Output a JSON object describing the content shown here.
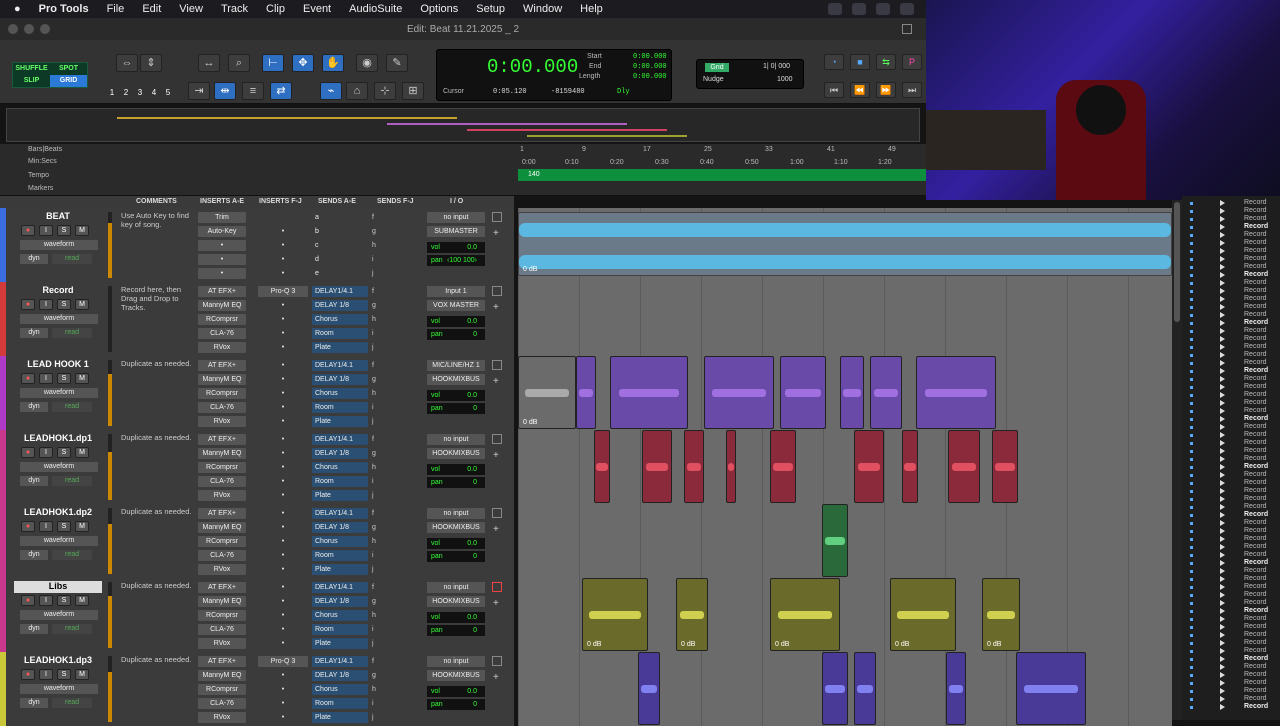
{
  "menubar": {
    "app": "Pro Tools",
    "items": [
      "File",
      "Edit",
      "View",
      "Track",
      "Clip",
      "Event",
      "AudioSuite",
      "Options",
      "Setup",
      "Window",
      "Help"
    ]
  },
  "window_title": "Edit: Beat 11.21.2025 _ 2",
  "modes": {
    "shuffle": "SHUFFLE",
    "spot": "SPOT",
    "slip": "SLIP",
    "grid": "GRID"
  },
  "toolbar": {
    "numbers": [
      "1",
      "2",
      "3",
      "4",
      "5"
    ]
  },
  "counter": {
    "main": "0:00.000",
    "start_lbl": "Start",
    "end_lbl": "End",
    "length_lbl": "Length",
    "start": "0:00.000",
    "end": "0:00.000",
    "length": "0:00.000",
    "cursor_lbl": "Cursor",
    "cursor": "0:05.120",
    "sample": "-8159480",
    "dly": "Dly"
  },
  "grid": {
    "grid_lbl": "Grid",
    "grid_val": "1| 0| 000",
    "nudge_lbl": "Nudge",
    "nudge_val": "1000"
  },
  "rulers": {
    "bars": "Bars|Beats",
    "min": "Min:Secs",
    "tempo": "Tempo",
    "markers": "Markers",
    "tempo_val": "140",
    "bar_ticks": [
      "1",
      "9",
      "17",
      "25",
      "33",
      "41",
      "49"
    ],
    "sec_ticks": [
      "0:00",
      "0:10",
      "0:20",
      "0:30",
      "0:40",
      "0:50",
      "1:00",
      "1:10",
      "1:20"
    ]
  },
  "columns": {
    "comments": "COMMENTS",
    "inserts_ae": "INSERTS A-E",
    "inserts_fj": "INSERTS F-J",
    "sends_ae": "SENDS A-E",
    "sends_fj": "SENDS F-J",
    "io": "I / O"
  },
  "tracks": [
    {
      "name": "BEAT",
      "color": "#3a6ee0",
      "comment": "Use Auto Key to find key of song.",
      "inserts": [
        "Trim",
        "Auto-Key",
        "•",
        "•",
        "•"
      ],
      "insfj": [
        "",
        "•",
        "•",
        "•",
        "•"
      ],
      "sends": [
        "a",
        "b",
        "c",
        "d",
        "e"
      ],
      "sendfj": [
        "f",
        "g",
        "h",
        "i",
        "j"
      ],
      "input": "no input",
      "output": "SUBMASTER",
      "vol": "0.0",
      "pan": "‹100   100›",
      "mode": "waveform",
      "dyn": "dyn",
      "read": "read",
      "clip_label": "0 dB"
    },
    {
      "name": "Record",
      "color": "#d33a3a",
      "comment": "Record here, then Drag and Drop to Tracks.",
      "inserts": [
        "AT EFX+",
        "MannyM EQ",
        "RComprsr",
        "CLA-76",
        "RVox"
      ],
      "insfj": [
        "Pro-Q 3",
        "•",
        "•",
        "•",
        "•"
      ],
      "sends": [
        "DELAY1/4.1",
        "DELAY 1/8",
        "Chorus",
        "Room",
        "Plate"
      ],
      "sendfj": [
        "f",
        "g",
        "h",
        "i",
        "j"
      ],
      "input": "Input 1",
      "output": "VOX MASTER",
      "vol": "0.0",
      "pan": "0",
      "mode": "waveform",
      "dyn": "dyn",
      "read": "read",
      "clip_label": ""
    },
    {
      "name": "LEAD HOOK 1",
      "color": "#b03ac8",
      "comment": "Duplicate as needed.",
      "inserts": [
        "AT EFX+",
        "MannyM EQ",
        "RComprsr",
        "CLA-76",
        "RVox"
      ],
      "insfj": [
        "•",
        "•",
        "•",
        "•",
        "•"
      ],
      "sends": [
        "DELAY1/4.1",
        "DELAY 1/8",
        "Chorus",
        "Room",
        "Plate"
      ],
      "sendfj": [
        "f",
        "g",
        "h",
        "i",
        "j"
      ],
      "input": "MIC/LINE/HZ 1",
      "output": "HOOKMIXBUS",
      "vol": "0.0",
      "pan": "0",
      "mode": "waveform",
      "dyn": "dyn",
      "read": "read",
      "clip_label": "0 dB"
    },
    {
      "name": "LEADHOK1.dp1",
      "color": "#c8388c",
      "comment": "Duplicate as needed.",
      "inserts": [
        "AT EFX+",
        "MannyM EQ",
        "RComprsr",
        "CLA-76",
        "RVox"
      ],
      "insfj": [
        "•",
        "•",
        "•",
        "•",
        "•"
      ],
      "sends": [
        "DELAY1/4.1",
        "DELAY 1/8",
        "Chorus",
        "Room",
        "Plate"
      ],
      "sendfj": [
        "f",
        "g",
        "h",
        "i",
        "j"
      ],
      "input": "no input",
      "output": "HOOKMIXBUS",
      "vol": "0.0",
      "pan": "0",
      "mode": "waveform",
      "dyn": "dyn",
      "read": "read",
      "clip_label": ""
    },
    {
      "name": "LEADHOK1.dp2",
      "color": "#c8388c",
      "comment": "Duplicate as needed.",
      "inserts": [
        "AT EFX+",
        "MannyM EQ",
        "RComprsr",
        "CLA-76",
        "RVox"
      ],
      "insfj": [
        "•",
        "•",
        "•",
        "•",
        "•"
      ],
      "sends": [
        "DELAY1/4.1",
        "DELAY 1/8",
        "Chorus",
        "Room",
        "Plate"
      ],
      "sendfj": [
        "f",
        "g",
        "h",
        "i",
        "j"
      ],
      "input": "no input",
      "output": "HOOKMIXBUS",
      "vol": "0.0",
      "pan": "0",
      "mode": "waveform",
      "dyn": "dyn",
      "read": "read",
      "clip_label": ""
    },
    {
      "name": "Libs",
      "color": "#c8388c",
      "comment": "Duplicate as needed.",
      "inserts": [
        "AT EFX+",
        "MannyM EQ",
        "RComprsr",
        "CLA-76",
        "RVox"
      ],
      "insfj": [
        "•",
        "•",
        "•",
        "•",
        "•"
      ],
      "sends": [
        "DELAY1/4.1",
        "DELAY 1/8",
        "Chorus",
        "Room",
        "Plate"
      ],
      "sendfj": [
        "f",
        "g",
        "h",
        "i",
        "j"
      ],
      "input": "no input",
      "output": "HOOKMIXBUS",
      "vol": "0.0",
      "pan": "0",
      "mode": "waveform",
      "dyn": "dyn",
      "read": "read",
      "clip_label": "0 dB"
    },
    {
      "name": "LEADHOK1.dp3",
      "color": "#c8c838",
      "comment": "Duplicate as needed.",
      "inserts": [
        "AT EFX+",
        "MannyM EQ",
        "RComprsr",
        "CLA-76",
        "RVox"
      ],
      "insfj": [
        "Pro-Q 3",
        "•",
        "•",
        "•",
        "•"
      ],
      "sends": [
        "DELAY1/4.1",
        "DELAY 1/8",
        "Chorus",
        "Room",
        "Plate"
      ],
      "sendfj": [
        "f",
        "g",
        "h",
        "i",
        "j"
      ],
      "input": "no input",
      "output": "HOOKMIXBUS",
      "vol": "0.0",
      "pan": "0",
      "mode": "waveform",
      "dyn": "dyn",
      "read": "read",
      "clip_label": ""
    }
  ],
  "labels": {
    "vol": "vol",
    "pan": "pan"
  },
  "right_panel": {
    "item": "Record"
  }
}
